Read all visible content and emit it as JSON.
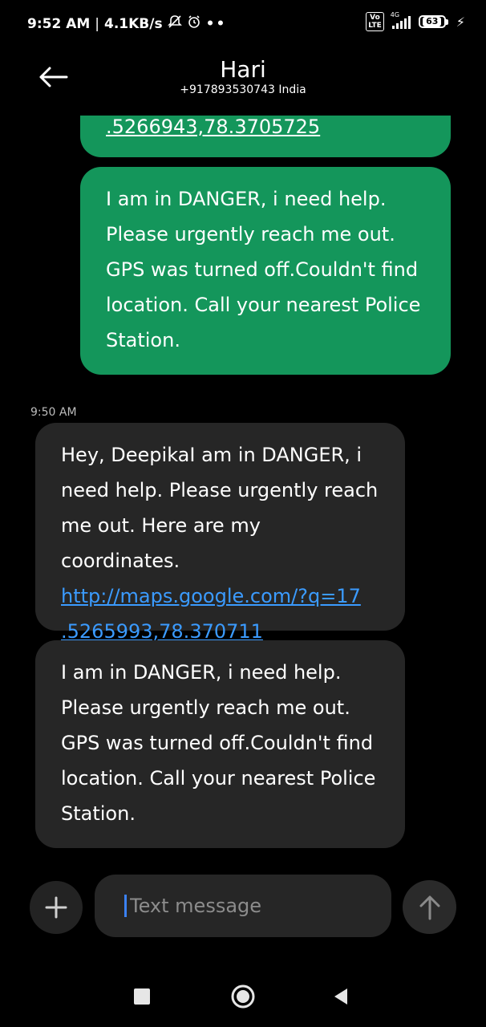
{
  "status_bar": {
    "time": "9:52 AM",
    "net_speed": "4.1KB/s",
    "volte": "Vo LTE",
    "network_type": "4G",
    "battery": "63"
  },
  "header": {
    "name": "Hari",
    "number": "+917893530743 India"
  },
  "messages": {
    "m0": {
      "link": ".5266943,78.3705725"
    },
    "m1": {
      "text": "I am in DANGER, i need help. Please urgently reach me out. GPS was turned off.Couldn't find location. Call your nearest Police Station."
    },
    "timestamp": "9:50 AM",
    "m2": {
      "text": "Hey, DeepikaI am in DANGER, i need help. Please urgently reach me out. Here are my coordinates.",
      "link": "http://maps.google.com/?q=17 .5265993,78.370711"
    },
    "m3": {
      "text": "I am in DANGER, i need help. Please urgently reach me out. GPS was turned off.Couldn't find location. Call your nearest Police Station."
    }
  },
  "composer": {
    "placeholder": "Text message",
    "add_icon": "plus-icon",
    "send_icon": "send-arrow-icon"
  },
  "colors": {
    "sent_bubble": "#14965b",
    "received_bubble": "#262626",
    "link": "#3b9bff",
    "background": "#000000"
  }
}
